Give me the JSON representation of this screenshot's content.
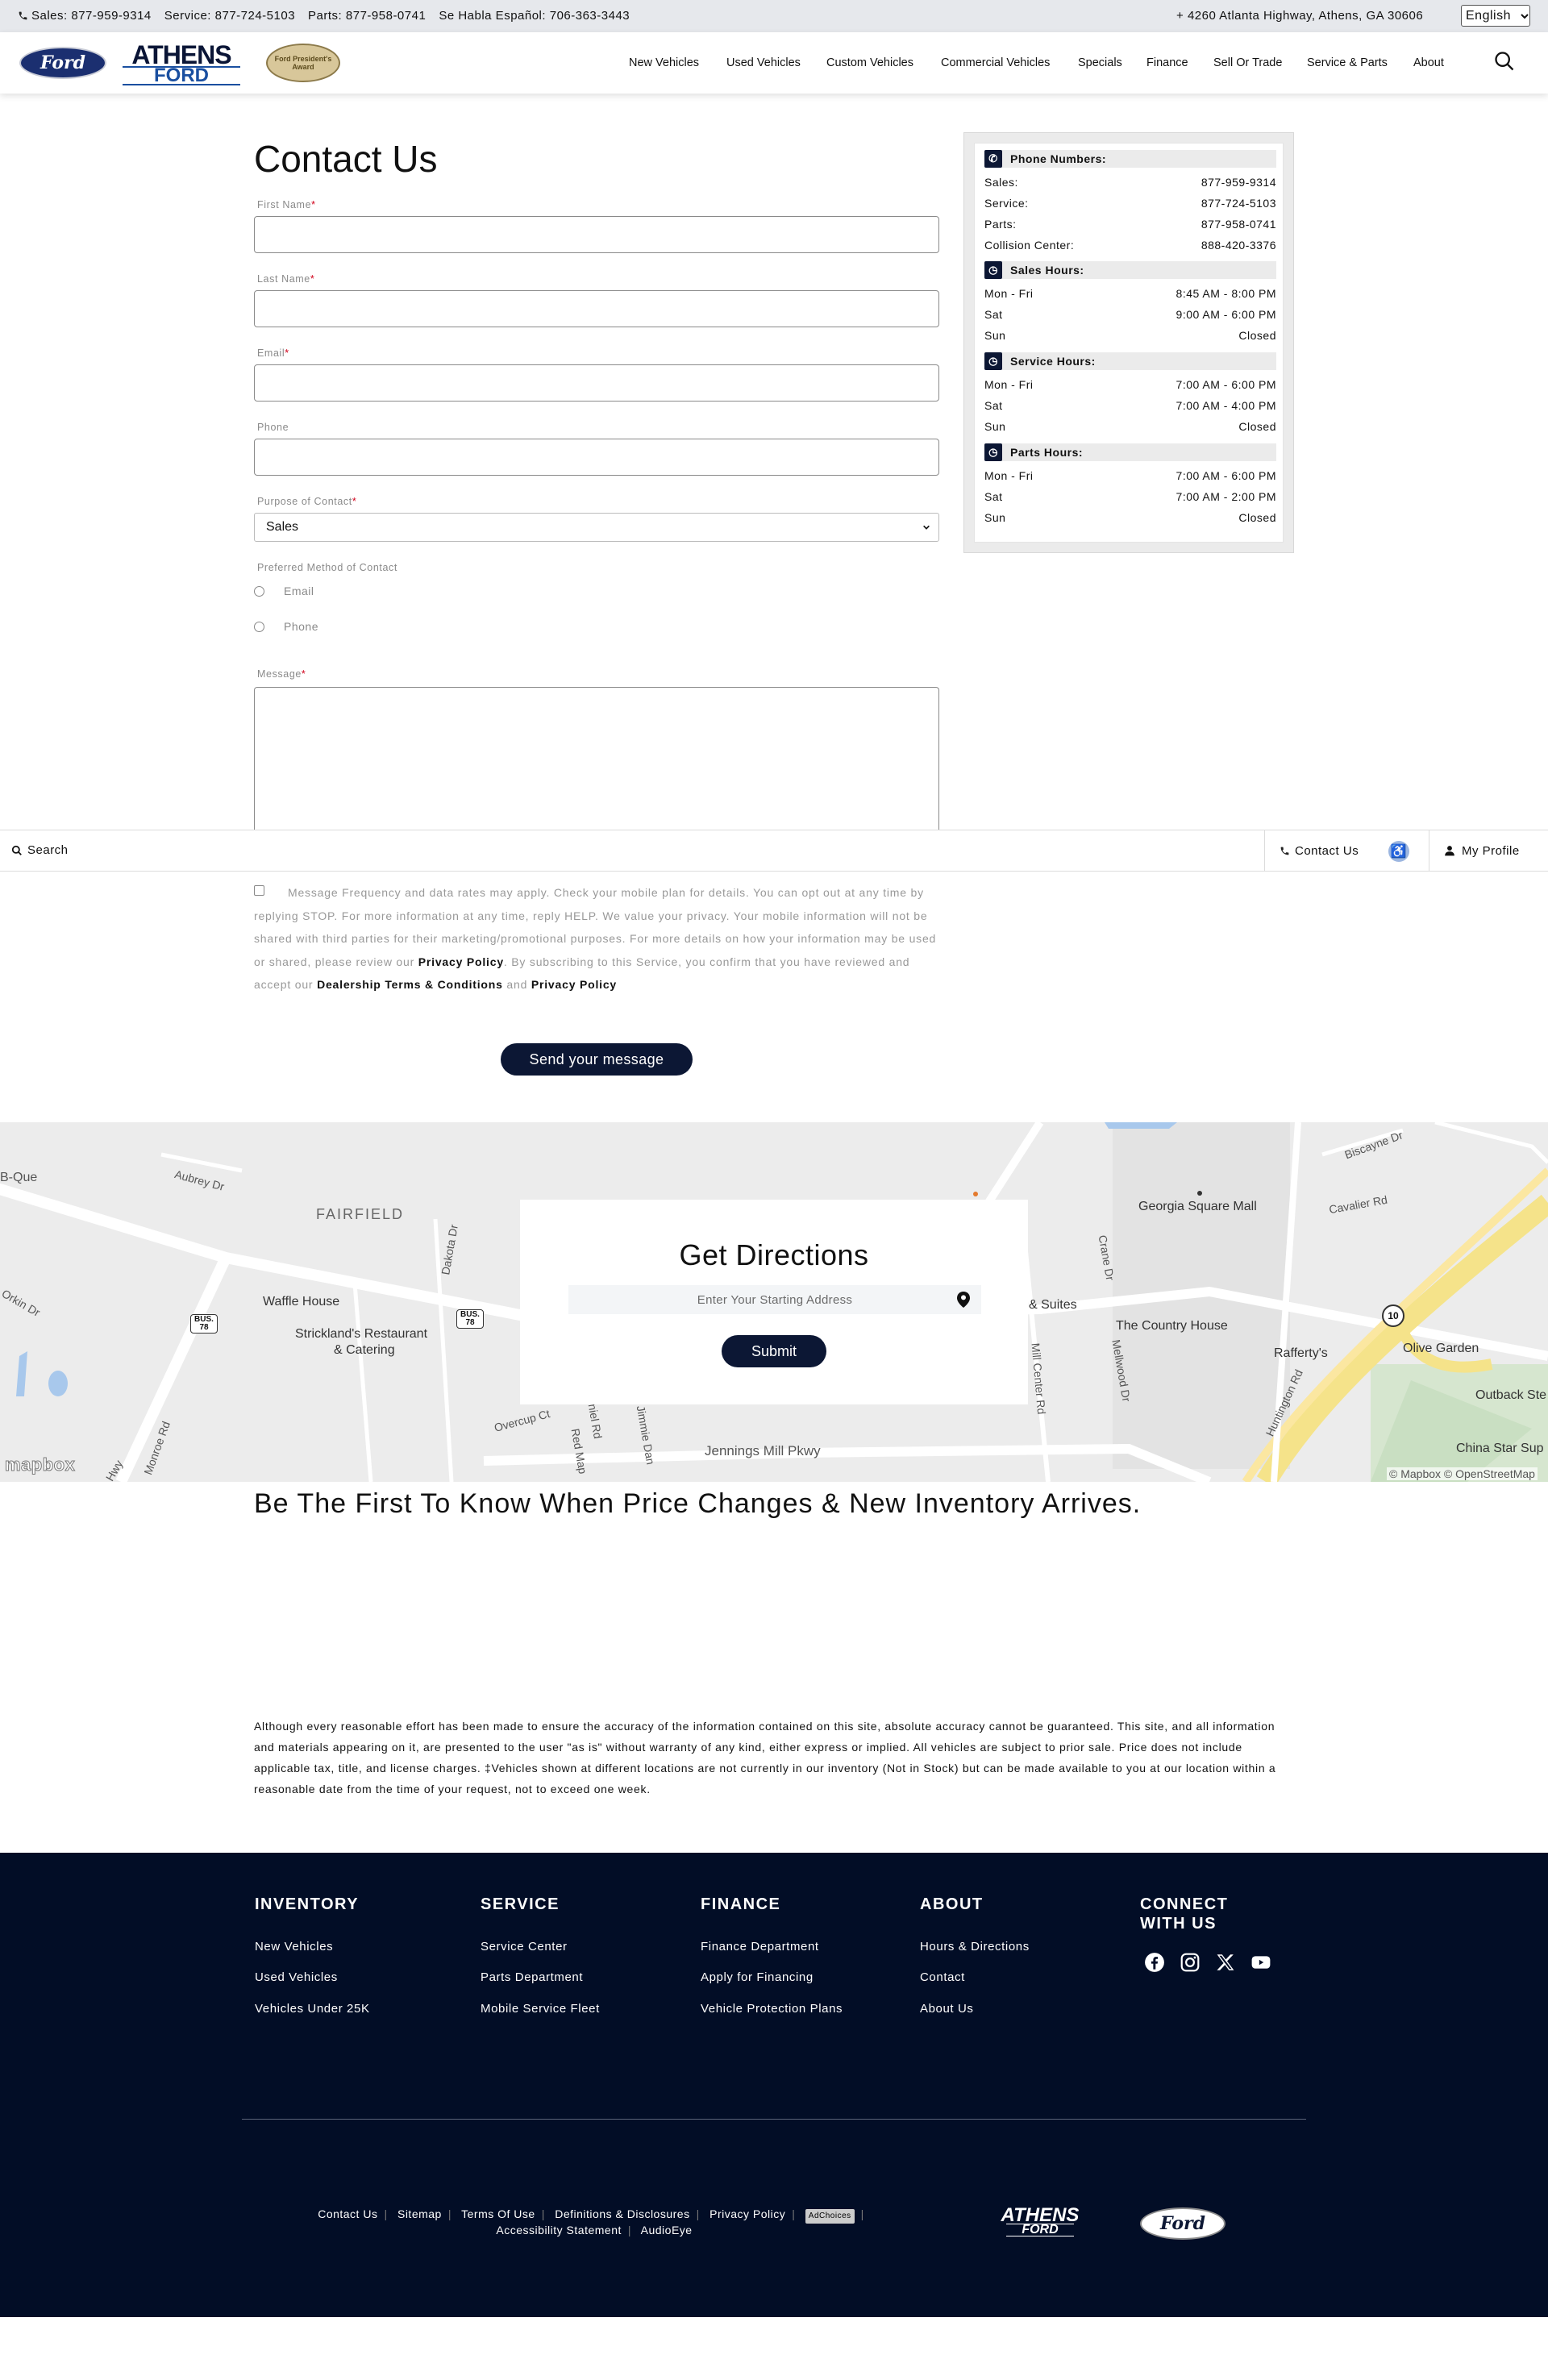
{
  "topbar": {
    "sales": "Sales: 877-959-9314",
    "service": "Service: 877-724-5103",
    "parts": "Parts: 877-958-0741",
    "spanish": "Se Habla Español: 706-363-3443",
    "address": "4260 Atlanta Highway, Athens, GA 30606",
    "language": "English"
  },
  "header": {
    "ford_logo": "Ford",
    "athens_logo_top": "ATHENS",
    "athens_logo_bottom": "FORD",
    "award_text": "Ford President's Award",
    "nav": [
      "New Vehicles",
      "Used Vehicles",
      "Custom Vehicles",
      "Commercial Vehicles",
      "Specials",
      "Finance",
      "Sell Or Trade",
      "Service & Parts",
      "About"
    ]
  },
  "form": {
    "title": "Contact Us",
    "first_name_label": "First Name",
    "last_name_label": "Last Name",
    "email_label": "Email",
    "phone_label": "Phone",
    "purpose_label": "Purpose of Contact",
    "purpose_value": "Sales",
    "preferred_label": "Preferred Method of Contact",
    "pref_email": "Email",
    "pref_phone": "Phone",
    "message_label": "Message",
    "required_mark": "*",
    "consent_text_1": "Message Frequency and data rates may apply. Check your mobile plan for details. You can opt out at any time by replying STOP. For more information at any time, reply HELP. We value your privacy. Your mobile information will not be shared with third parties for their marketing/promotional purposes. For more details on how your information may be used or shared, please review our ",
    "consent_link_1": "Privacy Policy",
    "consent_text_2": ". By subscribing to this Service, you confirm that you have reviewed and accept our ",
    "consent_link_2": "Dealership Terms & Conditions",
    "consent_text_3": " and ",
    "consent_link_3": "Privacy Policy",
    "send_label": "Send your message"
  },
  "stickybar": {
    "search": "Search",
    "contact": "Contact Us",
    "profile": "My Profile"
  },
  "sidebar": {
    "phone_title": "Phone Numbers:",
    "phones": [
      {
        "label": "Sales:",
        "value": "877-959-9314"
      },
      {
        "label": "Service:",
        "value": "877-724-5103"
      },
      {
        "label": "Parts:",
        "value": "877-958-0741"
      },
      {
        "label": "Collision Center:",
        "value": "888-420-3376"
      }
    ],
    "sales_title": "Sales Hours:",
    "sales_hours": [
      {
        "day": "Mon - Fri",
        "hours": "8:45 AM - 8:00 PM"
      },
      {
        "day": "Sat",
        "hours": "9:00 AM - 6:00 PM"
      },
      {
        "day": "Sun",
        "hours": "Closed"
      }
    ],
    "service_title": "Service Hours:",
    "service_hours": [
      {
        "day": "Mon - Fri",
        "hours": "7:00 AM - 6:00 PM"
      },
      {
        "day": "Sat",
        "hours": "7:00 AM - 4:00 PM"
      },
      {
        "day": "Sun",
        "hours": "Closed"
      }
    ],
    "parts_title": "Parts Hours:",
    "parts_hours": [
      {
        "day": "Mon - Fri",
        "hours": "7:00 AM - 6:00 PM"
      },
      {
        "day": "Sat",
        "hours": "7:00 AM - 2:00 PM"
      },
      {
        "day": "Sun",
        "hours": "Closed"
      }
    ]
  },
  "map": {
    "labels": [
      "B-Que",
      "Aubrey Dr",
      "FAIRFIELD",
      "Waffle House",
      "Strickland's Restaurant",
      "& Catering",
      "Dakota Dr",
      "Orkin Dr",
      "Georgia Square Mall",
      "Cavalier Rd",
      "Biscayne Dr",
      "& Suites",
      "The Country House",
      "Rafferty's",
      "Olive Garden",
      "Outback Ste",
      "China Star Sup",
      "Jennings Mill Pkwy",
      "Overcup Ct",
      "Daniel Rd",
      "Red Map",
      "Jimmie Dan",
      "Crane Dr",
      "Mill Center Rd",
      "Mellwood Dr",
      "Huntington Rd",
      "Monroe Rd",
      "Hwy"
    ],
    "route_shields": [
      "BUS. 78",
      "BUS. 78",
      "10"
    ],
    "attribution": "© Mapbox © OpenStreetMap",
    "mapbox_logo": "mapbox"
  },
  "directions": {
    "title": "Get Directions",
    "placeholder": "Enter Your Starting Address",
    "submit": "Submit"
  },
  "first_know": "Be The First To Know When Price Changes & New Inventory Arrives.",
  "disclaimer": "Although every reasonable effort has been made to ensure the accuracy of the information contained on this site, absolute accuracy cannot be guaranteed. This site, and all information and materials appearing on it, are presented to the user \"as is\" without warranty of any kind, either express or implied. All vehicles are subject to prior sale. Price does not include applicable tax, title, and license charges. ‡Vehicles shown at different locations are not currently in our inventory (Not in Stock) but can be made available to you at our location within a reasonable date from the time of your request, not to exceed one week.",
  "footer": {
    "inventory_title": "INVENTORY",
    "inventory": [
      "New Vehicles",
      "Used Vehicles",
      "Vehicles Under 25K"
    ],
    "service_title": "SERVICE",
    "service": [
      "Service Center",
      "Parts Department",
      "Mobile Service Fleet"
    ],
    "finance_title": "FINANCE",
    "finance": [
      "Finance Department",
      "Apply for Financing",
      "Vehicle Protection Plans"
    ],
    "about_title": "ABOUT",
    "about": [
      "Hours & Directions",
      "Contact",
      "About Us"
    ],
    "connect_title": "CONNECT WITH US",
    "bottom_links": [
      "Contact Us",
      "Sitemap",
      "Terms Of Use",
      "Definitions & Disclosures",
      "Privacy Policy"
    ],
    "adchoices": "AdChoices",
    "bottom_links_2": [
      "Accessibility Statement",
      "AudioEye"
    ],
    "athens_top": "ATHENS",
    "athens_bottom": "FORD",
    "ford": "Ford"
  },
  "colors": {
    "navy": "#0c1734",
    "footer_bg": "#020d26",
    "required": "#d0021b",
    "topbar_bg": "#e6e8ec"
  },
  "icons": [
    "phone-icon",
    "search-icon",
    "clock-icon",
    "map-pin-icon",
    "accessibility-icon",
    "user-icon",
    "facebook-icon",
    "instagram-icon",
    "x-icon",
    "youtube-icon",
    "chevron-down-icon"
  ]
}
